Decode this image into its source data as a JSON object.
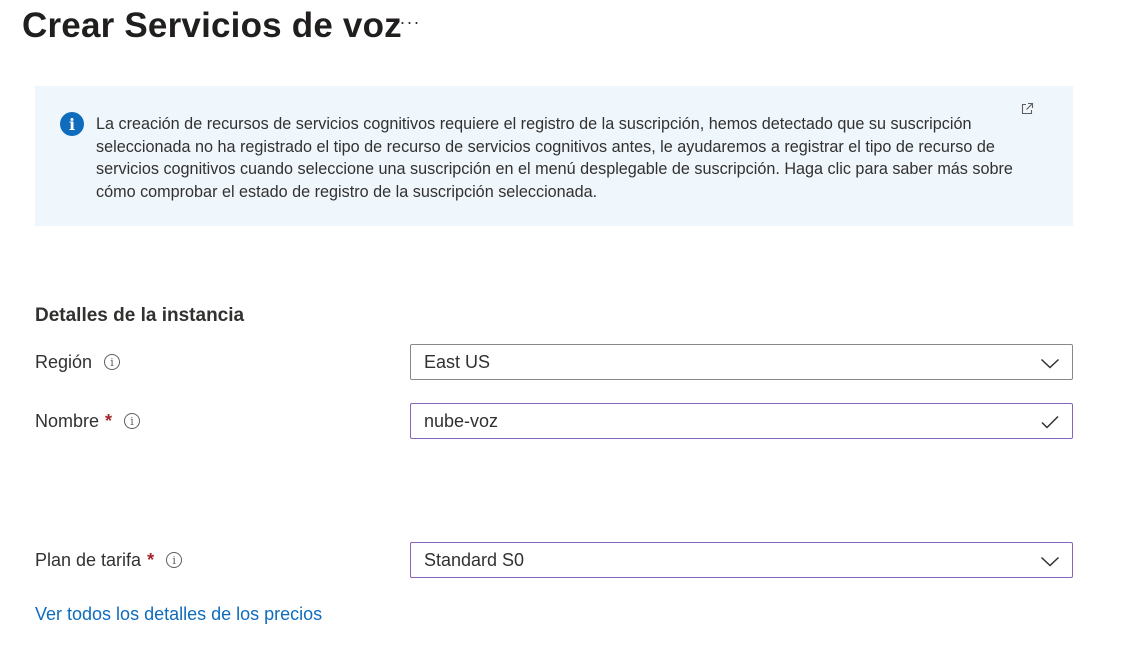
{
  "header": {
    "title": "Crear Servicios de voz",
    "more_label": "···"
  },
  "info_banner": {
    "message": "La creación de recursos de servicios cognitivos requiere el registro de la suscripción, hemos detectado que su suscripción seleccionada no ha registrado el tipo de recurso de servicios cognitivos antes, le ayudaremos a registrar el tipo de recurso de servicios cognitivos cuando seleccione una suscripción en el menú desplegable de suscripción. Haga clic para saber más sobre cómo comprobar el estado de registro de la suscripción seleccionada."
  },
  "instance": {
    "section_title": "Detalles de la instancia",
    "region": {
      "label": "Región",
      "value": "East US"
    },
    "name": {
      "label": "Nombre",
      "required": "*",
      "value": "nube-voz"
    }
  },
  "pricing": {
    "label": "Plan de tarifa",
    "required": "*",
    "value": "Standard S0",
    "details_link": "Ver todos los detalles de los precios"
  },
  "colors": {
    "accent": "#0f6cbd",
    "banner_bg": "#eff6fc",
    "required": "#a4262c",
    "focus_border": "#8764b8"
  },
  "icons": [
    "info-icon",
    "external-link-icon",
    "help-icon",
    "chevron-down-icon",
    "checkmark-icon"
  ]
}
